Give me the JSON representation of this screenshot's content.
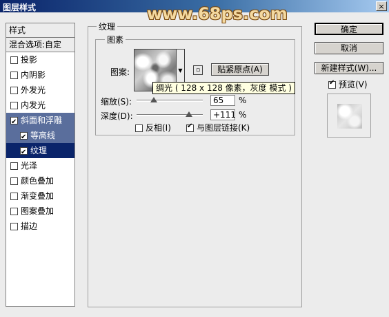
{
  "window": {
    "title": "图层样式",
    "close_label": "×"
  },
  "watermark": "www.68ps.com",
  "sidebar": {
    "header": "样式",
    "blend_options": "混合选项:自定",
    "items": [
      {
        "label": "投影",
        "checked": false
      },
      {
        "label": "内阴影",
        "checked": false
      },
      {
        "label": "外发光",
        "checked": false
      },
      {
        "label": "内发光",
        "checked": false
      },
      {
        "label": "斜面和浮雕",
        "checked": true
      },
      {
        "label": "等高线",
        "checked": true
      },
      {
        "label": "纹理",
        "checked": true
      },
      {
        "label": "光泽",
        "checked": false
      },
      {
        "label": "颜色叠加",
        "checked": false
      },
      {
        "label": "渐变叠加",
        "checked": false
      },
      {
        "label": "图案叠加",
        "checked": false
      },
      {
        "label": "描边",
        "checked": false
      }
    ]
  },
  "texture": {
    "section_title": "纹理",
    "elements_title": "图素",
    "pattern_label": "图案:",
    "snap_button": "贴紧原点(A)",
    "tooltip": "绸光 ( 128 x 128 像素，灰度 模式 )",
    "scale_label": "缩放(S):",
    "scale_value": "65",
    "scale_unit": "%",
    "scale_pct": 0.65,
    "depth_label": "深度(D):",
    "depth_value": "+111",
    "depth_unit": "%",
    "invert_label": "反相(I)",
    "invert_checked": false,
    "link_label": "与图层链接(K)",
    "link_checked": true
  },
  "buttons": {
    "ok": "确定",
    "cancel": "取消",
    "new_style": "新建样式(W)...",
    "preview_label": "预览(V)",
    "preview_checked": true
  }
}
